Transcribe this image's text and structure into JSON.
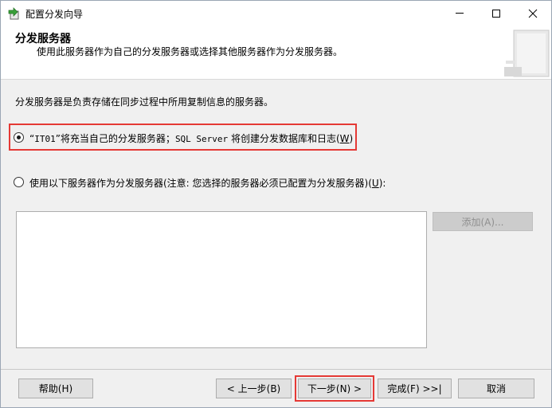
{
  "window": {
    "title": "配置分发向导",
    "icon": "wizard-app-icon"
  },
  "header": {
    "title": "分发服务器",
    "description": "使用此服务器作为自己的分发服务器或选择其他服务器作为分发服务器。"
  },
  "content": {
    "intro": "分发服务器是负责存储在同步过程中所用复制信息的服务器。",
    "option1": {
      "label_prefix": "“",
      "server": "IT01",
      "label_rest": "”将充当自己的分发服务器；",
      "sql": "SQL Server",
      "label_tail": " 将创建分发数据库和日志(",
      "hotkey": "W",
      "close": ")",
      "selected": true
    },
    "option2": {
      "label": "使用以下服务器作为分发服务器(注意: 您选择的服务器必须已配置为分发服务器)(",
      "hotkey": "U",
      "close": "):",
      "selected": false
    },
    "add_button": "添加(A)..."
  },
  "footer": {
    "help": "帮助(H)",
    "back": "< 上一步(B)",
    "next": "下一步(N) >",
    "finish": "完成(F) >>|",
    "cancel": "取消"
  },
  "colors": {
    "highlight": "#e53935",
    "background": "#f0f0f0"
  }
}
